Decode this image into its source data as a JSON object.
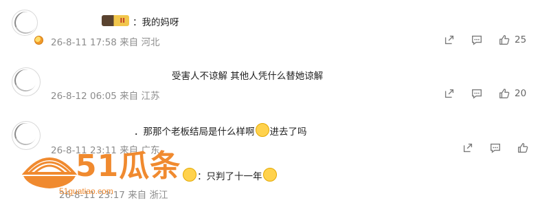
{
  "comments": [
    {
      "text": "：我的妈呀",
      "badge": "II",
      "date": "26-8-11 17:58",
      "location": "来自 河北",
      "likes": "25"
    },
    {
      "text": "受害人不谅解 其他人凭什么替她谅解",
      "date": "26-8-12 06:05",
      "location": "来自 江苏",
      "likes": "20"
    },
    {
      "text_a": "．那那个老板结局是什么样啊",
      "text_b": "进去了吗",
      "date": "26-8-11 23:11",
      "location": "来自 广东"
    },
    {
      "text_a": "：只判了十一年",
      "date": "26-8-11 23:17",
      "location": "来自 浙江"
    }
  ],
  "watermark": {
    "brand": "51瓜条",
    "url": "51guatiao.com"
  },
  "icons": [
    "share-icon",
    "comment-icon",
    "like-icon"
  ],
  "colors": {
    "watermark": "#f08a2f",
    "meta": "#8c8c8c",
    "icon": "#7a7a7a"
  }
}
